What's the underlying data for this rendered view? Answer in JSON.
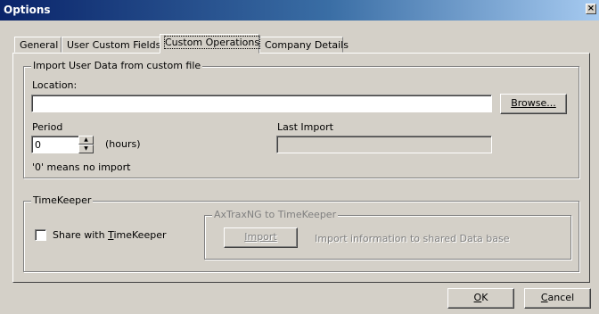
{
  "window": {
    "title": "Options",
    "close_glyph": "×"
  },
  "tabs": [
    {
      "label": "General"
    },
    {
      "label": "User Custom Fields"
    },
    {
      "label": "Custom Operations"
    },
    {
      "label": "Company Details"
    }
  ],
  "import_group": {
    "legend": "Import User Data from custom file",
    "location_label": "Location:",
    "location_value": "",
    "browse_label": "Browse...",
    "period_label": "Period",
    "period_value": "0",
    "period_units": "(hours)",
    "period_hint": "'0' means no import",
    "last_import_label": "Last Import",
    "last_import_value": ""
  },
  "timekeeper_group": {
    "legend": "TimeKeeper",
    "share_pre": "Share with ",
    "share_key": "T",
    "share_post": "imeKeeper",
    "share_checked": false,
    "sub_legend": "AxTraxNG to TimeKeeper",
    "import_label": "Import",
    "import_desc": "Import information to shared Data base"
  },
  "footer": {
    "ok_key": "O",
    "ok_rest": "K",
    "cancel_key": "C",
    "cancel_rest": "ancel"
  },
  "icons": {
    "spin_up": "▲",
    "spin_down": "▼"
  }
}
